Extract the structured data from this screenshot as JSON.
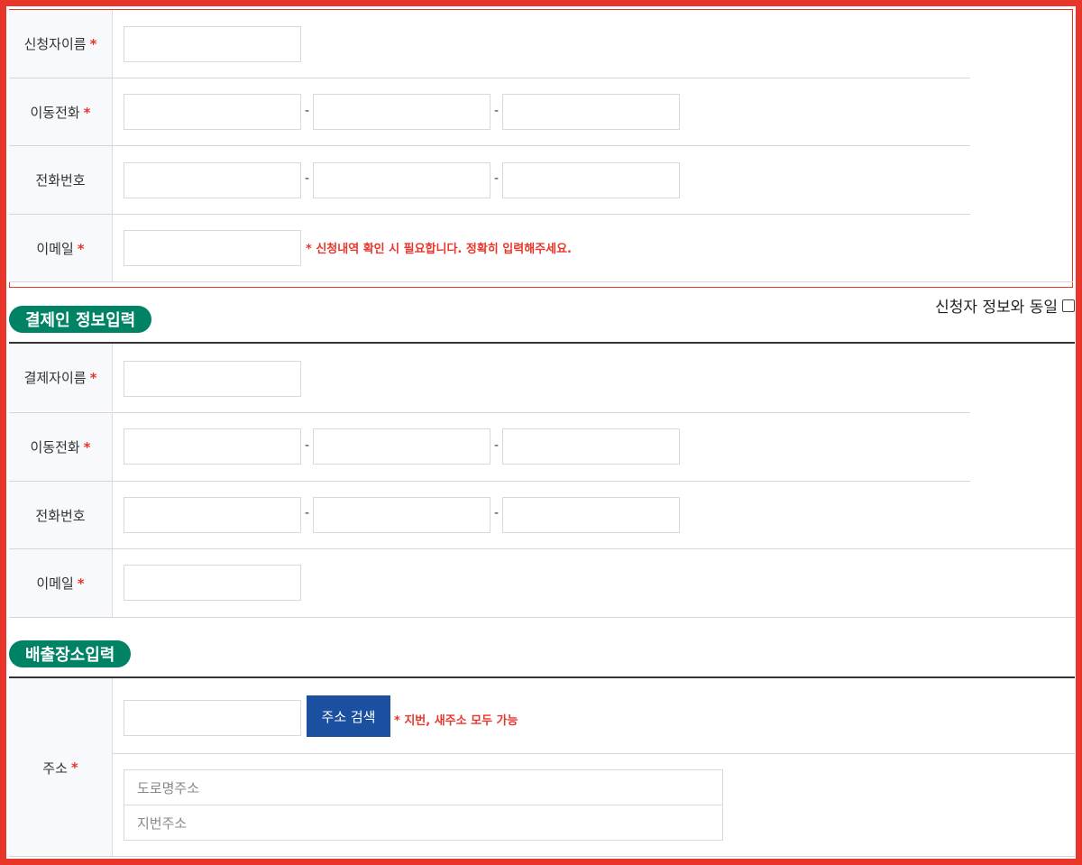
{
  "applicant": {
    "name_label": "신청자이름",
    "mobile_label": "이동전화",
    "phone_label": "전화번호",
    "email_label": "이메일",
    "email_note": "* 신청내역 확인 시 필요합니다. 정확히 입력해주세요.",
    "required_mark": "*",
    "dash": "-"
  },
  "payer": {
    "title": "결제인 정보입력",
    "same_as_applicant": "신청자 정보와 동일",
    "name_label": "결제자이름",
    "mobile_label": "이동전화",
    "phone_label": "전화번호",
    "email_label": "이메일"
  },
  "discharge": {
    "title": "배출장소입력",
    "address_label": "주소",
    "search_button": "주소 검색",
    "address_note": "* 지번, 새주소 모두 가능",
    "road_placeholder": "도로명주소",
    "jibun_placeholder": "지번주소"
  },
  "colors": {
    "accent_red": "#e8362b",
    "section_green": "#008265",
    "button_blue": "#1b4fa0"
  }
}
